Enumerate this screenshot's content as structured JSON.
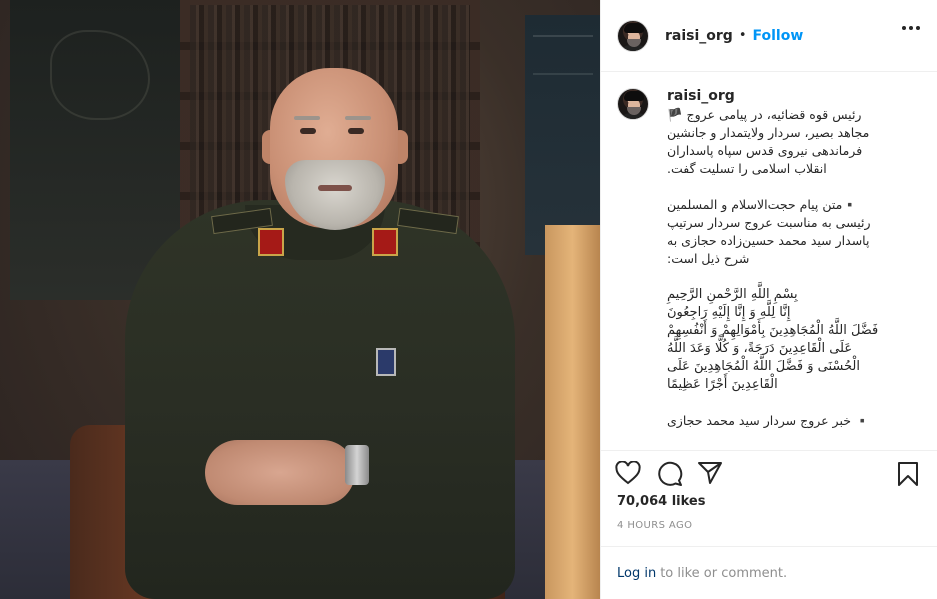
{
  "post": {
    "username": "raisi_org",
    "follow_label": "Follow",
    "separator": "•"
  },
  "caption": {
    "username": "raisi_org",
    "paragraphs": [
      "رئیس قوه قضائیه، در پیامی عروج 🏴\nمجاهد بصیر، سردار ولایتمدار و جانشین\nفرماندهی نیروی قدس سپاه پاسداران\nانقلاب اسلامی را تسلیت گفت.",
      "▪️متن پیام حجت‌الاسلام و المسلمین\nرئیسی به مناسبت عروج سردار سرتیپ\nپاسدار سید محمد حسین‌زاده حجازی به\nشرح ذیل است:",
      "بِسْمِ اللَّهِ الرَّحْمنِ الرَّحِیمِ\nإِنَّا لِلَّهِ وَ إِنَّا إِلَیْهِ رَاجِعُونَ\nفَضَّلَ اللَّهُ الْمُجَاهِدِینَ بِأَمْوَالِهِمْ وَ أَنْفُسِهِمْ\nعَلَى الْقَاعِدِینَ دَرَجَةً، وَ كُلًّا وَعَدَ اللَّهُ\nالْحُسْنَى وَ فَضَّلَ اللَّهُ الْمُجَاهِدِینَ عَلَى\nالْقَاعِدِینَ أَجْرًا عَظِیمًا",
      "▪️ خبر عروج سردار سید محمد حجازی"
    ]
  },
  "stats": {
    "likes": "70,064 likes",
    "time": "4 HOURS AGO"
  },
  "footer": {
    "login_label": "Log in",
    "rest": "to like or comment."
  },
  "icons": {
    "more": "more-options-icon",
    "like": "heart-icon",
    "comment": "comment-icon",
    "share": "share-icon",
    "save": "bookmark-icon"
  },
  "colors": {
    "follow": "#0095f6",
    "link": "#00376b",
    "muted": "#8e8e8e",
    "text": "#262626"
  }
}
